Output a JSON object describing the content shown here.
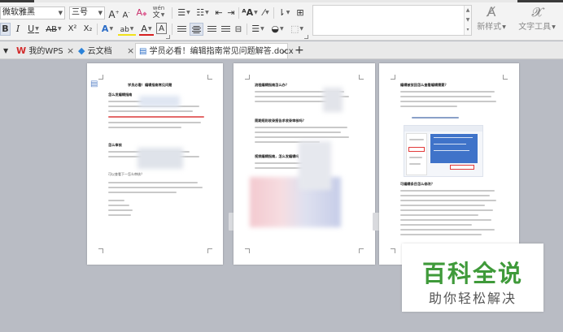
{
  "ribbon": {
    "font_name": "微软雅黑",
    "font_size": "三号",
    "grow_font_label": "A",
    "shrink_font_label": "A",
    "clear_format_label": "A",
    "pinyin_label": "wén",
    "bold_label": "B",
    "italic_label": "I",
    "underline_label": "U",
    "strikethrough_label": "AB",
    "superscript_label": "X²",
    "subscript_label": "X₂",
    "text_effect_label": "A",
    "highlight_label": "ab",
    "font_color_label": "A",
    "char_border_label": "A",
    "new_style_label": "新样式",
    "text_tools_label": "文字工具",
    "highlight_color": "#f0e11a",
    "font_color": "#d62020",
    "accent_color": "#2a6cc7"
  },
  "tabs": {
    "my_wps": "我的WPS",
    "cloud_docs": "云文档",
    "document": "学员必看！编辑指南常见问题解答.docx",
    "close_symbol": "×",
    "add_symbol": "+"
  },
  "pages": {
    "p1": {
      "title": "学员必看！编辑指南常见问题",
      "h1": "怎么发编辑指南",
      "h2": "怎么审核",
      "q1": "可以查看下一怎么审核？"
    },
    "p2": {
      "h1": "流程编辑指南怎么办？",
      "h2": "周期规则收录报告求收录审核吗？",
      "h3": "视频编辑指南，怎么发编辑吗"
    },
    "p3": {
      "h1": "编辑被驳回怎么查看编辑需要？",
      "h2": "可编辑条目怎么修改？"
    }
  },
  "watermark": {
    "title": "百科全说",
    "subtitle": "助你轻松解决"
  }
}
